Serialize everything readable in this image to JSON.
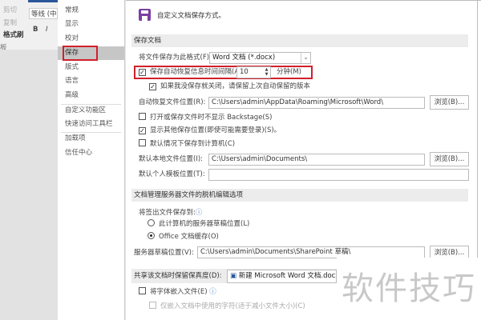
{
  "ribbon": {
    "cut": "剪切",
    "copy": "复制",
    "format_painter": "格式刷",
    "font": "等线 (中",
    "bold": "B",
    "italic": "I",
    "clipboard": "板"
  },
  "nav": {
    "items": [
      "常规",
      "显示",
      "校对",
      "保存",
      "版式",
      "语言",
      "高级",
      "自定义功能区",
      "快速访问工具栏",
      "加载项",
      "信任中心"
    ],
    "selected": "保存"
  },
  "main": {
    "header": "自定义文档保存方式。",
    "section1": "保存文档",
    "format_label": "将文件保存为此格式(F):",
    "format_value": "Word 文档 (*.docx)",
    "autosave_label": "保存自动恢复信息时间间隔(A)",
    "autosave_value": "10",
    "autosave_unit": "分钟(M)",
    "keep_last": "如果我没保存就关闭，请保留上次自动保留的版本",
    "autorecover_label": "自动恢复文件位置(R):",
    "autorecover_path": "C:\\Users\\admin\\AppData\\Roaming\\Microsoft\\Word\\",
    "browse": "浏览(B)...",
    "no_backstage": "打开或保存文件时不显示 Backstage(S)",
    "show_other": "显示其他保存位置(即使可能需要登录)(S)。",
    "save_computer": "默认情况下保存到计算机(C)",
    "local_label": "默认本地文件位置(I):",
    "local_path": "C:\\Users\\admin\\Documents\\",
    "template_label": "默认个人模板位置(T):",
    "template_path": "",
    "section2": "文档管理服务器文件的脱机编辑选项",
    "checkout_label": "将签出文件保存到:",
    "radio1": "此计算机的服务器草稿位置(L)",
    "radio2": "Office 文档缓存(O)",
    "server_label": "服务器草稿位置(V):",
    "server_path": "C:\\Users\\admin\\Documents\\SharePoint 草稿\\",
    "share_label": "共享该文档时保留保真度(D):",
    "share_doc": "新建 Microsoft Word 文档.docx",
    "embed_fonts": "将字体嵌入文件(E)",
    "embed_used": "仅嵌入文档中使用的字符(适于减小文件大小)(C)"
  },
  "watermark": "软件技巧",
  "colors": {
    "highlight": "#d0202a",
    "save_icon": "#7a3fa0"
  }
}
